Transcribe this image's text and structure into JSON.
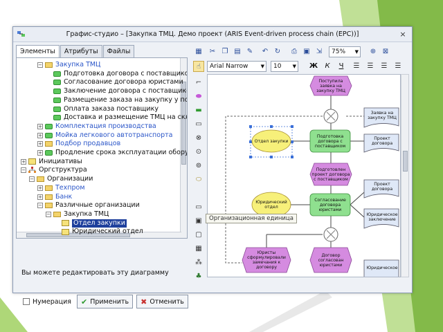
{
  "window": {
    "title": "Графис-студио – [Закупка ТМЦ. Демо проект (ARIS Event-driven process chain (EPC))]",
    "close_glyph": "×"
  },
  "left_pane": {
    "tabs": [
      "Элементы",
      "Атрибуты",
      "Файлы"
    ],
    "tree": [
      {
        "text": "Закупка ТМЦ",
        "indent": 2,
        "icon": "folder",
        "color": "blue",
        "exp": "−"
      },
      {
        "text": "Подготовка договора с поставщиком",
        "indent": 3,
        "icon": "green",
        "color": "black"
      },
      {
        "text": "Согласование договора юристами",
        "indent": 3,
        "icon": "green",
        "color": "black"
      },
      {
        "text": "Заключение договора с поставщиком",
        "indent": 3,
        "icon": "green",
        "color": "black"
      },
      {
        "text": "Размещение заказа на закупку у поставщика",
        "indent": 3,
        "icon": "green",
        "color": "black"
      },
      {
        "text": "Оплата заказа поставщику",
        "indent": 3,
        "icon": "green",
        "color": "black"
      },
      {
        "text": "Доставка и размещение ТМЦ на складе",
        "indent": 3,
        "icon": "green",
        "color": "black"
      },
      {
        "text": "Комплектация производства",
        "indent": 2,
        "icon": "green",
        "color": "blue",
        "exp": "+"
      },
      {
        "text": "Мойка легкового автотранспорта",
        "indent": 2,
        "icon": "green",
        "color": "blue",
        "exp": "+"
      },
      {
        "text": "Подбор продавцов",
        "indent": 2,
        "icon": "folder",
        "color": "blue",
        "exp": "+"
      },
      {
        "text": "Продление срока эксплуатации оборудования",
        "indent": 2,
        "icon": "green",
        "color": "black",
        "exp": "+"
      },
      {
        "text": "Инициативы",
        "indent": 0,
        "icon": "square",
        "color": "black",
        "exp": "+"
      },
      {
        "text": "Оргструктура",
        "indent": 0,
        "icon": "org",
        "color": "black",
        "exp": "−"
      },
      {
        "text": "Организации",
        "indent": 1,
        "icon": "folder",
        "color": "black",
        "exp": "−"
      },
      {
        "text": "Техпром",
        "indent": 2,
        "icon": "folder",
        "color": "blue",
        "exp": "+"
      },
      {
        "text": "Банк",
        "indent": 2,
        "icon": "folder",
        "color": "blue",
        "exp": "+"
      },
      {
        "text": "Различные организации",
        "indent": 2,
        "icon": "folder",
        "color": "black",
        "exp": "−"
      },
      {
        "text": "Закупка ТМЦ",
        "indent": 3,
        "icon": "folder",
        "color": "black",
        "exp": "−"
      },
      {
        "text": "Отдел закупки",
        "indent": 4,
        "icon": "square",
        "color": "selected"
      },
      {
        "text": "Юридический отдел",
        "indent": 4,
        "icon": "square",
        "color": "black"
      }
    ],
    "status_message": "Вы можете редактировать эту диаграмму",
    "numbering_label": "Нумерация",
    "apply_label": "Применить",
    "cancel_label": "Отменить",
    "apply_glyph": "✔",
    "cancel_glyph": "✖"
  },
  "toolbar": {
    "font_name": "Arial Narrow",
    "font_size": "10",
    "zoom": "75%",
    "bold": "Ж",
    "italic": "К",
    "underline": "Ч"
  },
  "diagram": {
    "tooltip": "Организационная единица",
    "shapes": {
      "event_1": "Поступила заявка на закупку ТМЦ",
      "doc_request": "Заявка на закупку ТМЦ",
      "org_purchase": "Отдел закупки",
      "func_prepare": "Подготовка договора с поставщиком",
      "doc_draft": "Проект договора",
      "event_prepared": "Подготовлен проект договора с поставщиком",
      "doc_draft_2": "Проект договора",
      "org_legal": "Юридический отдел",
      "func_approve": "Согласование договора юристами",
      "doc_legal_opinion": "Юридическое заключение",
      "event_remarks": "Юристы сформулировали замечания к договору",
      "event_approved": "Договор согласован юристами",
      "doc_legal_2": "Юридическое"
    },
    "colors": {
      "event": "#d58be0",
      "function": "#8fe08f",
      "org": "#f7f07a",
      "document": "#dfe8f7",
      "selection": "#3a6fd8"
    }
  }
}
